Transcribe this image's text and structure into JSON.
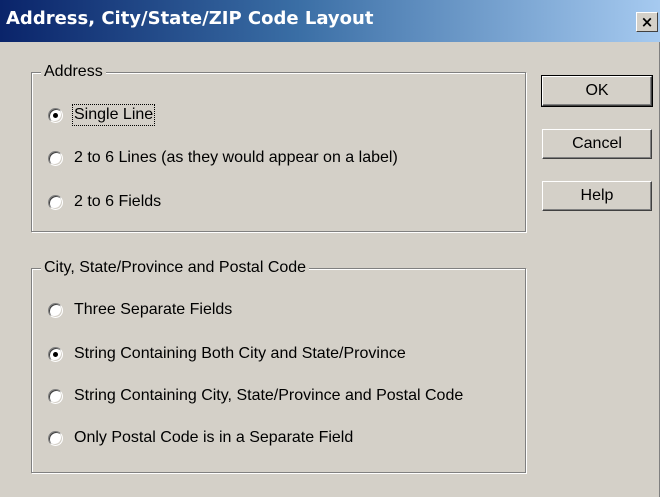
{
  "window": {
    "title": "Address, City/State/ZIP Code Layout",
    "close_label": "×"
  },
  "address_group": {
    "label": "Address",
    "options": [
      {
        "label": "Single Line",
        "checked": true
      },
      {
        "label": "2 to 6 Lines (as they would appear on a label)",
        "checked": false
      },
      {
        "label": "2 to 6 Fields",
        "checked": false
      }
    ]
  },
  "city_group": {
    "label": "City, State/Province and Postal Code",
    "options": [
      {
        "label": "Three Separate Fields",
        "checked": false
      },
      {
        "label": "String Containing Both City and State/Province",
        "checked": true
      },
      {
        "label": "String Containing City, State/Province and Postal Code",
        "checked": false
      },
      {
        "label": "Only Postal Code is in a Separate Field",
        "checked": false
      }
    ]
  },
  "buttons": {
    "ok": "OK",
    "cancel": "Cancel",
    "help": "Help"
  }
}
